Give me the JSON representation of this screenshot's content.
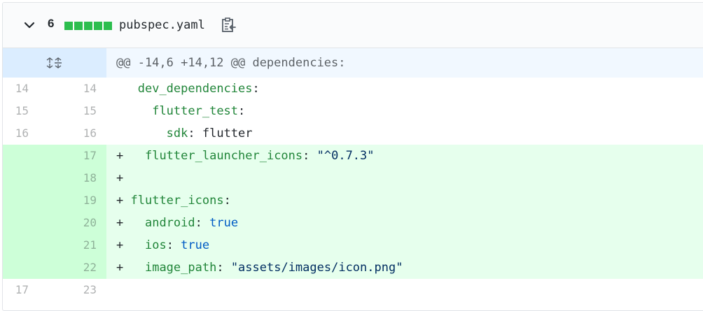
{
  "file": {
    "changes_count": "6",
    "diffstat_blocks": 5,
    "diffstat_color": "#2cbe4e",
    "filename": "pubspec.yaml",
    "icons": [
      "chevron-down-icon",
      "clippy-icon",
      "unfold-icon"
    ]
  },
  "hunk": {
    "header": "@@ -14,6 +14,12 @@ dependencies:"
  },
  "lines": [
    {
      "type": "context",
      "old": "14",
      "new": "14",
      "marker": " ",
      "indent": "  ",
      "key": "dev_dependencies",
      "sep": ":",
      "value": "",
      "vtype": ""
    },
    {
      "type": "context",
      "old": "15",
      "new": "15",
      "marker": " ",
      "indent": "    ",
      "key": "flutter_test",
      "sep": ":",
      "value": "",
      "vtype": ""
    },
    {
      "type": "context",
      "old": "16",
      "new": "16",
      "marker": " ",
      "indent": "      ",
      "key": "sdk",
      "sep": ":",
      "value": " flutter",
      "vtype": "plain"
    },
    {
      "type": "add",
      "old": "",
      "new": "17",
      "marker": "+",
      "indent": "   ",
      "key": "flutter_launcher_icons",
      "sep": ":",
      "value": " \"^0.7.3\"",
      "vtype": "string"
    },
    {
      "type": "add",
      "old": "",
      "new": "18",
      "marker": "+",
      "indent": "",
      "key": "",
      "sep": "",
      "value": "",
      "vtype": ""
    },
    {
      "type": "add",
      "old": "",
      "new": "19",
      "marker": "+",
      "indent": " ",
      "key": "flutter_icons",
      "sep": ":",
      "value": "",
      "vtype": ""
    },
    {
      "type": "add",
      "old": "",
      "new": "20",
      "marker": "+",
      "indent": "   ",
      "key": "android",
      "sep": ":",
      "value": " true",
      "vtype": "bool"
    },
    {
      "type": "add",
      "old": "",
      "new": "21",
      "marker": "+",
      "indent": "   ",
      "key": "ios",
      "sep": ":",
      "value": " true",
      "vtype": "bool"
    },
    {
      "type": "add",
      "old": "",
      "new": "22",
      "marker": "+",
      "indent": "   ",
      "key": "image_path",
      "sep": ":",
      "value": " \"assets/images/icon.png\"",
      "vtype": "string"
    },
    {
      "type": "context",
      "old": "17",
      "new": "23",
      "marker": " ",
      "indent": "",
      "key": "",
      "sep": "",
      "value": "",
      "vtype": ""
    }
  ]
}
